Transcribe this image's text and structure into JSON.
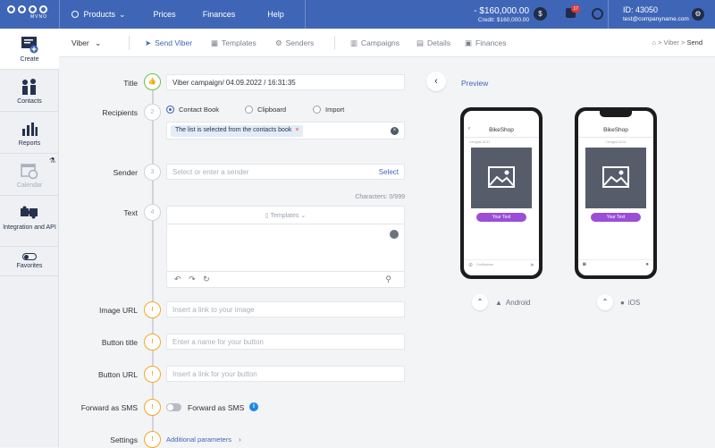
{
  "topbar": {
    "logo_sub": "MVNO",
    "nav": {
      "products": "Products",
      "prices": "Prices",
      "finances": "Finances",
      "help": "Help"
    },
    "balance": "- $160,000.00",
    "credit": "Credit: $160,000.00",
    "notif_count": "17",
    "account_id": "ID: 43050",
    "account_email": "test@companyname.com"
  },
  "sidebar": {
    "items": [
      {
        "label": "Create",
        "icon": "create-icon"
      },
      {
        "label": "Contacts",
        "icon": "contacts-icon"
      },
      {
        "label": "Reports",
        "icon": "reports-icon"
      },
      {
        "label": "Calendar",
        "icon": "calendar-icon"
      },
      {
        "label": "Integration and API",
        "icon": "puzzle-icon"
      },
      {
        "label": "Favorites",
        "icon": "toggle-icon"
      }
    ]
  },
  "subbar": {
    "channel": "Viber",
    "tabs": [
      "Send Viber",
      "Templates",
      "Senders",
      "Campaigns",
      "Details",
      "Finances"
    ],
    "breadcrumb": [
      "Viber",
      "Send"
    ]
  },
  "form": {
    "title_label": "Title",
    "title_value": "Viber campaign/ 04.09.2022 / 16:31:35",
    "recipients_label": "Recipients",
    "recipients_step": "2",
    "recipient_options": [
      "Contact Book",
      "Clipboard",
      "Import"
    ],
    "recipient_chip": "The list is selected from the contacts book",
    "sender_label": "Sender",
    "sender_step": "3",
    "sender_placeholder": "Select or enter a sender",
    "sender_select": "Select",
    "characters": "Characters:  0/999",
    "text_label": "Text",
    "text_step": "4",
    "templates_label": "Templates",
    "image_url_label": "Image URL",
    "image_url_placeholder": "Insert a link to your image",
    "button_title_label": "Button title",
    "button_title_placeholder": "Enter a name for your button",
    "button_url_label": "Button URL",
    "button_url_placeholder": "Insert a link for your button",
    "forward_label": "Forward as SMS",
    "forward_toggle_label": "Forward as SMS",
    "settings_label": "Settings",
    "additional_params": "Additional parameters"
  },
  "preview": {
    "title": "Preview",
    "shop_name": "BikeShop",
    "date": "Сегодня 16:31",
    "button_text": "Your Text",
    "input_placeholder": "Сообщение",
    "android_label": "Android",
    "ios_label": "iOS"
  },
  "colors": {
    "brand": "#3f66b6",
    "success": "#6cc04a",
    "warning": "#f5a623",
    "cta": "#9a4fd6"
  }
}
